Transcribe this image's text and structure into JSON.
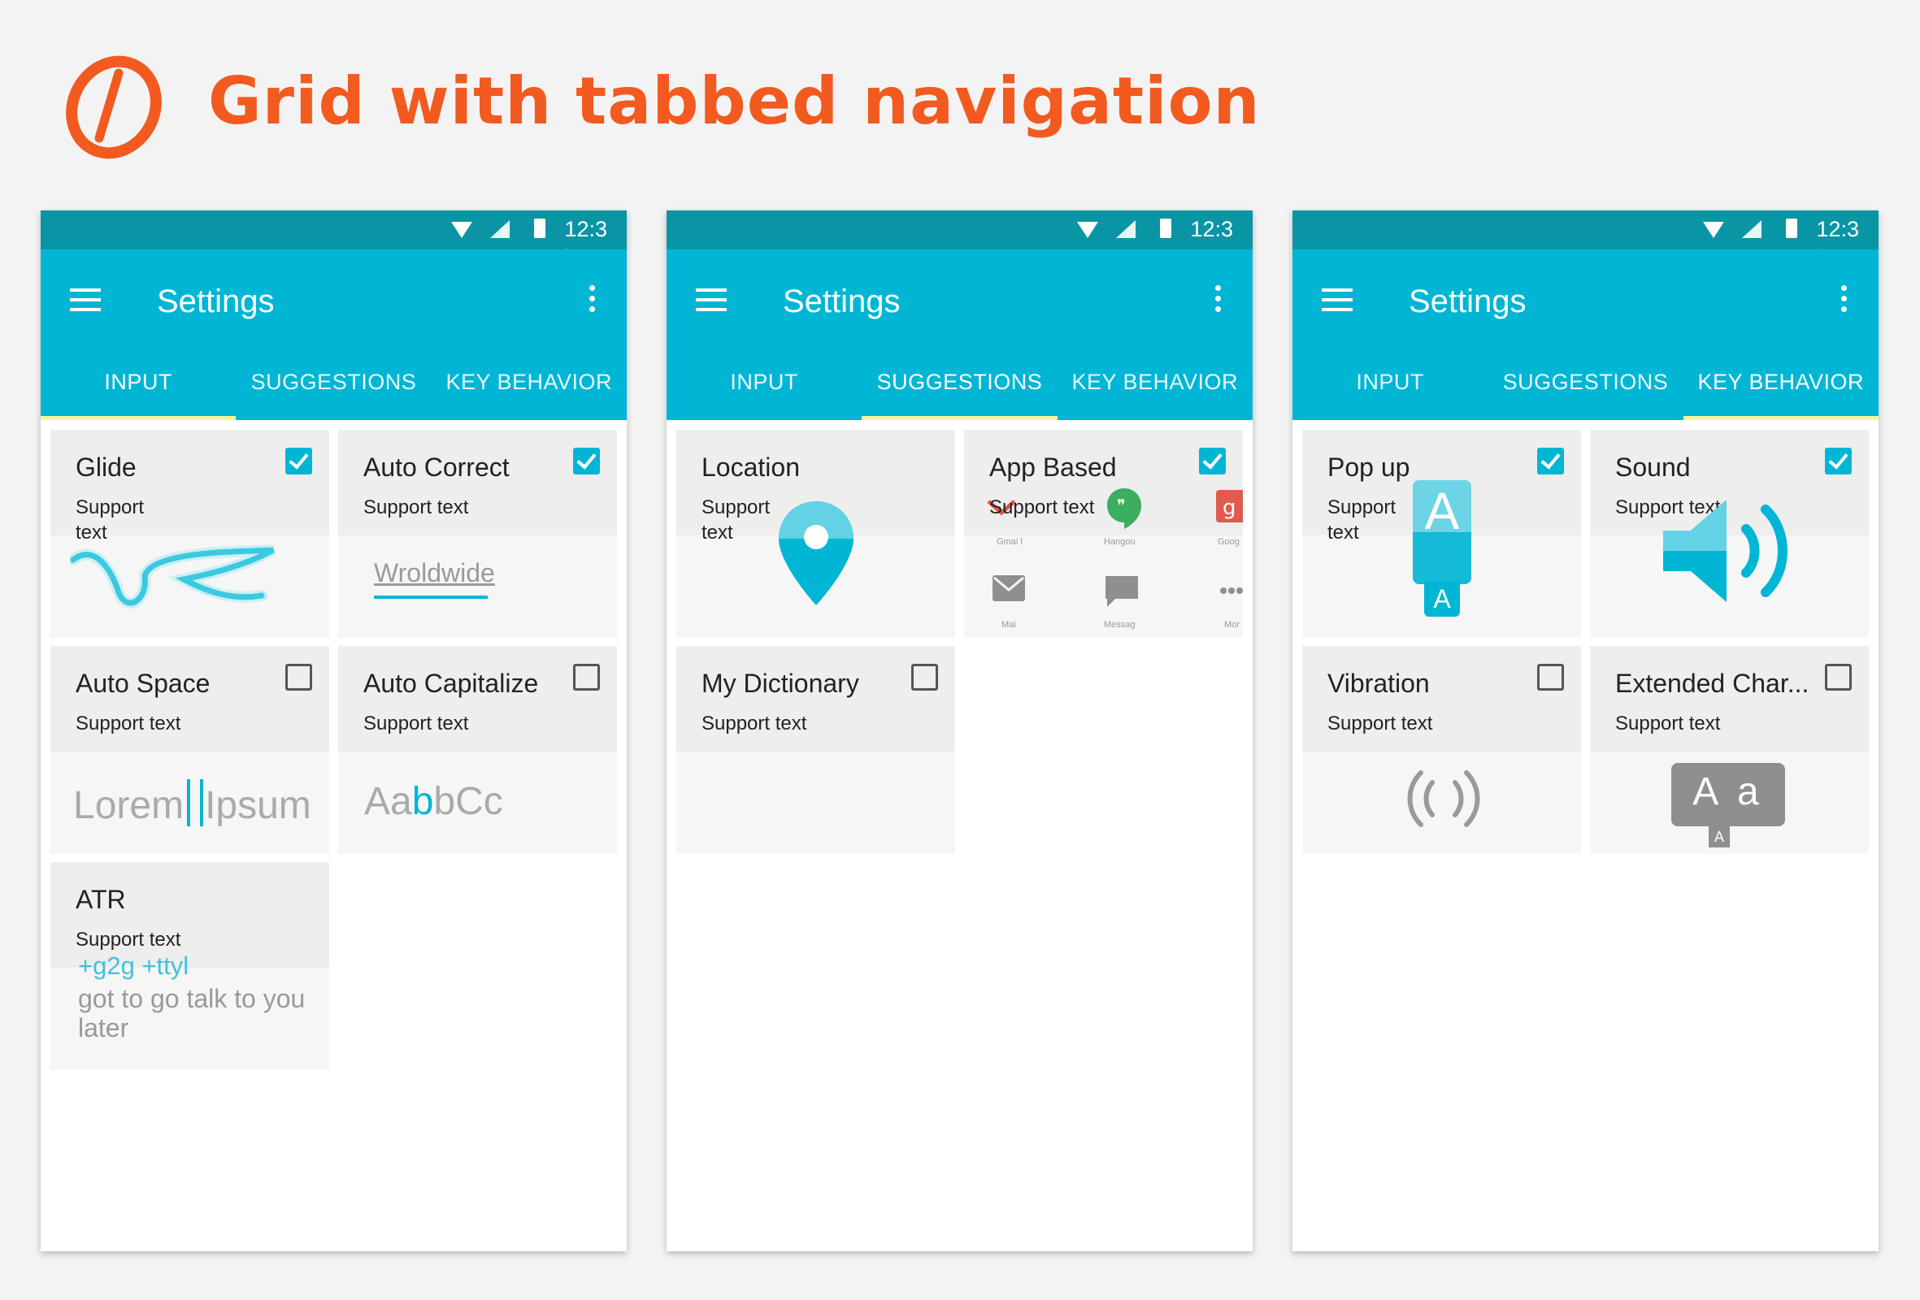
{
  "page": {
    "title": "Grid with tabbed navigation",
    "accent_color": "#f25a1f",
    "logo_icon": "circle-slash-logo"
  },
  "phones": [
    {
      "status_time": "12:3",
      "status_time_wrap": "0",
      "app_title": "Settings",
      "tabs": [
        "INPUT",
        "SUGGESTIONS",
        "KEY BEHAVIOR"
      ],
      "active_tab": "INPUT",
      "cards": [
        {
          "title": "Glide",
          "support": "Support text",
          "checked": true
        },
        {
          "title": "Auto Correct",
          "support": "Support text",
          "checked": true,
          "sample": "Wroldwide"
        },
        {
          "title": "Auto Space",
          "support": "Support text",
          "checked": false,
          "sample_left": "Lorem",
          "sample_right": "Ipsum"
        },
        {
          "title": "Auto Capitalize",
          "support": "Support text",
          "checked": false,
          "sample_a": "Aa",
          "sample_b": "b",
          "sample_c": "bCc"
        },
        {
          "title": "ATR",
          "support": "Support text",
          "tags": "+g2g +ttyl",
          "sample": "got to go talk to you later"
        }
      ]
    },
    {
      "status_time": "12:3",
      "app_title": "Settings",
      "tabs": [
        "INPUT",
        "SUGGESTIONS",
        "KEY BEHAVIOR"
      ],
      "active_tab": "SUGGESTIONS",
      "cards": [
        {
          "title": "Location",
          "support": "Support text",
          "icon": "map-pin-icon"
        },
        {
          "title": "App Based",
          "support": "Support text",
          "checked": true,
          "apps": [
            "Gmai l",
            "Hangou",
            "Goog",
            "Mai",
            "Messag",
            "Mor"
          ]
        },
        {
          "title": "My Dictionary",
          "support": "Support text",
          "checked": false
        }
      ]
    },
    {
      "status_time": "12:3",
      "status_time_wrap": "0",
      "app_title": "Settings",
      "tabs": [
        "INPUT",
        "SUGGESTIONS",
        "KEY BEHAVIOR"
      ],
      "active_tab": "KEY BEHAVIOR",
      "cards": [
        {
          "title": "Pop up",
          "support": "Support text",
          "checked": true,
          "key_big": "A",
          "key_small": "A"
        },
        {
          "title": "Sound",
          "support": "Support text",
          "checked": true,
          "icon": "speaker-icon"
        },
        {
          "title": "Vibration",
          "support": "Support text",
          "checked": false,
          "icon": "vibration-icon"
        },
        {
          "title": "Extended Char...",
          "support": "Support text",
          "checked": false,
          "key_big": "A a",
          "key_small": "A"
        }
      ]
    }
  ],
  "colors": {
    "primary": "#00b6d4",
    "status_bar": "#0a95a5",
    "tab_indicator": "#f4f49a"
  }
}
